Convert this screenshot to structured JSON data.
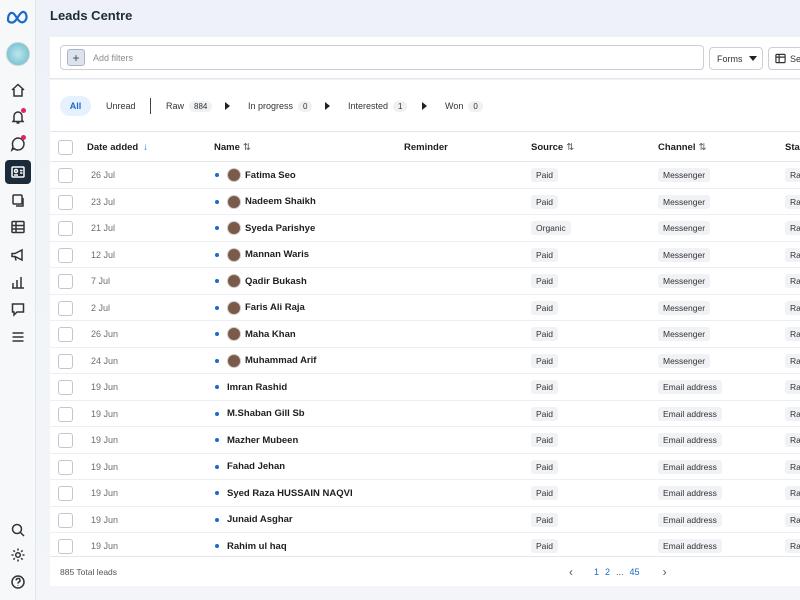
{
  "app": {
    "title": "Leads Centre"
  },
  "rail": {
    "icons": [
      "meta-logo-icon",
      "page-avatar",
      "home-icon",
      "bell-icon",
      "chat-icon",
      "leads-icon",
      "copy-icon",
      "table-icon",
      "megaphone-icon",
      "chart-icon",
      "feedback-icon",
      "menu-icon",
      "search-icon",
      "gear-icon",
      "help-icon"
    ]
  },
  "filters": {
    "placeholder": "Add filters",
    "plus": "+",
    "forms_label": "Forms",
    "settings_label": "Se"
  },
  "tabs": [
    {
      "label": "All"
    },
    {
      "label": "Unread"
    },
    {
      "label": "Raw",
      "count": "884"
    },
    {
      "label": "In progress",
      "count": "0"
    },
    {
      "label": "Interested",
      "count": "1"
    },
    {
      "label": "Won",
      "count": "0"
    }
  ],
  "columns": {
    "date": "Date added",
    "date_arrow": "↓",
    "name": "Name",
    "name_sort": "⇅",
    "reminder": "Reminder",
    "source": "Source",
    "source_sort": "⇅",
    "channel": "Channel",
    "channel_sort": "⇅",
    "stage": "Sta"
  },
  "rows": [
    {
      "date": "26 Jul",
      "name": "Fatima Seo",
      "source": "Paid",
      "channel": "Messenger",
      "stage": "Ra",
      "photo": true
    },
    {
      "date": "23 Jul",
      "name": "Nadeem Shaikh",
      "source": "Paid",
      "channel": "Messenger",
      "stage": "Ra",
      "photo": true
    },
    {
      "date": "21 Jul",
      "name": "Syeda Parishye",
      "source": "Organic",
      "channel": "Messenger",
      "stage": "Ra",
      "photo": true
    },
    {
      "date": "12 Jul",
      "name": "Mannan Waris",
      "source": "Paid",
      "channel": "Messenger",
      "stage": "Ra",
      "photo": true
    },
    {
      "date": "7 Jul",
      "name": "Qadir Bukash",
      "source": "Paid",
      "channel": "Messenger",
      "stage": "Ra",
      "photo": true
    },
    {
      "date": "2 Jul",
      "name": "Faris Ali Raja",
      "source": "Paid",
      "channel": "Messenger",
      "stage": "Ra",
      "photo": true
    },
    {
      "date": "26 Jun",
      "name": "Maha Khan",
      "source": "Paid",
      "channel": "Messenger",
      "stage": "Ra",
      "photo": true
    },
    {
      "date": "24 Jun",
      "name": "Muhammad Arif",
      "source": "Paid",
      "channel": "Messenger",
      "stage": "Ra",
      "photo": true
    },
    {
      "date": "19 Jun",
      "name": "Imran Rashid",
      "source": "Paid",
      "channel": "Email address",
      "stage": "Ra",
      "photo": false
    },
    {
      "date": "19 Jun",
      "name": "M.Shaban Gill Sb",
      "source": "Paid",
      "channel": "Email address",
      "stage": "Ra",
      "photo": false
    },
    {
      "date": "19 Jun",
      "name": "Mazher Mubeen",
      "source": "Paid",
      "channel": "Email address",
      "stage": "Ra",
      "photo": false
    },
    {
      "date": "19 Jun",
      "name": "Fahad Jehan",
      "source": "Paid",
      "channel": "Email address",
      "stage": "Ra",
      "photo": false
    },
    {
      "date": "19 Jun",
      "name": "Syed Raza HUSSAIN NAQVI",
      "source": "Paid",
      "channel": "Email address",
      "stage": "Ra",
      "photo": false
    },
    {
      "date": "19 Jun",
      "name": "Junaid Asghar",
      "source": "Paid",
      "channel": "Email address",
      "stage": "Ra",
      "photo": false
    },
    {
      "date": "19 Jun",
      "name": "Rahim ul haq",
      "source": "Paid",
      "channel": "Email address",
      "stage": "Ra",
      "photo": false
    }
  ],
  "footer": {
    "total": "885 Total leads",
    "prev": "‹",
    "pages": [
      "1",
      "2",
      "...",
      "45"
    ],
    "next": "›"
  },
  "colors": {
    "accent": "#1b6ac9",
    "rail_active": "#1c2b3a"
  }
}
